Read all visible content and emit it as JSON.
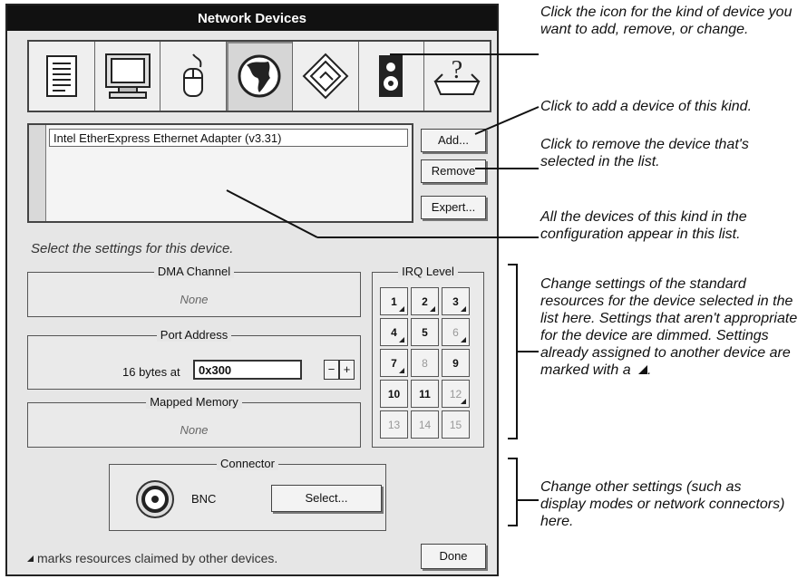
{
  "window": {
    "title": "Network Devices"
  },
  "device_icons": [
    {
      "name": "document-icon"
    },
    {
      "name": "monitor-icon"
    },
    {
      "name": "mouse-icon"
    },
    {
      "name": "globe-icon"
    },
    {
      "name": "diamond-icon"
    },
    {
      "name": "speaker-icon"
    },
    {
      "name": "help-drive-icon"
    }
  ],
  "device_list": {
    "items": [
      "Intel EtherExpress Ethernet Adapter (v3.31)"
    ]
  },
  "buttons": {
    "add": "Add...",
    "remove": "Remove",
    "expert": "Expert...",
    "select": "Select...",
    "done": "Done"
  },
  "hint": "Select the settings for this device.",
  "dma": {
    "label": "DMA Channel",
    "value": "None"
  },
  "port": {
    "label": "Port Address",
    "prefix": "16 bytes at",
    "value": "0x300",
    "minus": "−",
    "plus": "+"
  },
  "mapped": {
    "label": "Mapped Memory",
    "value": "None"
  },
  "irq": {
    "label": "IRQ Level",
    "cells": [
      {
        "n": "1",
        "state": "taken"
      },
      {
        "n": "2",
        "state": "taken"
      },
      {
        "n": "3",
        "state": "taken"
      },
      {
        "n": "4",
        "state": "taken"
      },
      {
        "n": "5",
        "state": "normal"
      },
      {
        "n": "6",
        "state": "taken-dim"
      },
      {
        "n": "7",
        "state": "taken"
      },
      {
        "n": "8",
        "state": "dim"
      },
      {
        "n": "9",
        "state": "normal"
      },
      {
        "n": "10",
        "state": "normal"
      },
      {
        "n": "11",
        "state": "normal"
      },
      {
        "n": "12",
        "state": "taken-dim"
      },
      {
        "n": "13",
        "state": "dim"
      },
      {
        "n": "14",
        "state": "dim"
      },
      {
        "n": "15",
        "state": "dim"
      }
    ]
  },
  "connector": {
    "label": "Connector",
    "value": "BNC"
  },
  "footer_note": "marks resources claimed by other devices.",
  "callouts": [
    "Click the icon for the kind of device you want to add, remove, or change.",
    "Click to add a device of this kind.",
    "Click to remove the device that's selected in the list.",
    "All the devices of this kind in the configuration appear in this list.",
    "Change settings of the standard resources for the device selected in the list here. Settings that aren't appropriate for the device are dimmed. Settings already assigned to another device are marked with a",
    "Change other settings (such as display modes or network connectors) here."
  ]
}
